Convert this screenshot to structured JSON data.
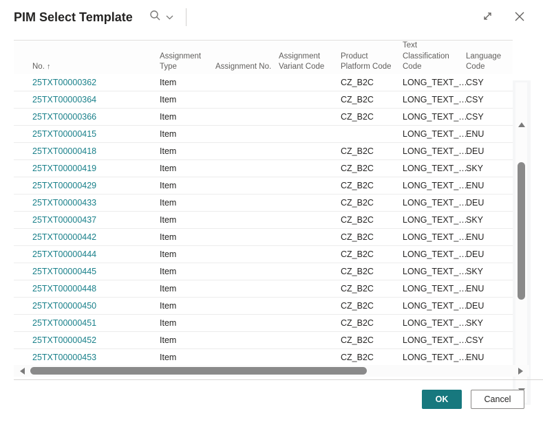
{
  "window": {
    "title": "PIM Select Template"
  },
  "icons": {
    "search": "search-magnifier",
    "chevron": "chevron-down",
    "expand": "expand-diagonal",
    "close": "close-x"
  },
  "table": {
    "columns": [
      {
        "key": "no",
        "label": "No.",
        "sort": "↑"
      },
      {
        "key": "assignment_type",
        "label": "Assignment Type"
      },
      {
        "key": "assignment_no",
        "label": "Assignment No."
      },
      {
        "key": "assignment_variant_code",
        "label": "Assignment Variant Code"
      },
      {
        "key": "product_platform_code",
        "label": "Product Platform Code"
      },
      {
        "key": "text_classification_code",
        "label": "Text Classification Code"
      },
      {
        "key": "language_code",
        "label": "Language Code"
      }
    ],
    "rows": [
      {
        "no": "25TXT00000362",
        "assignment_type": "Item",
        "assignment_no": "",
        "assignment_variant_code": "",
        "product_platform_code": "CZ_B2C",
        "text_classification_code": "LONG_TEXT_…",
        "language_code": "CSY"
      },
      {
        "no": "25TXT00000364",
        "assignment_type": "Item",
        "assignment_no": "",
        "assignment_variant_code": "",
        "product_platform_code": "CZ_B2C",
        "text_classification_code": "LONG_TEXT_…",
        "language_code": "CSY"
      },
      {
        "no": "25TXT00000366",
        "assignment_type": "Item",
        "assignment_no": "",
        "assignment_variant_code": "",
        "product_platform_code": "CZ_B2C",
        "text_classification_code": "LONG_TEXT_…",
        "language_code": "CSY"
      },
      {
        "no": "25TXT00000415",
        "assignment_type": "Item",
        "assignment_no": "",
        "assignment_variant_code": "",
        "product_platform_code": "",
        "text_classification_code": "LONG_TEXT_…",
        "language_code": "ENU"
      },
      {
        "no": "25TXT00000418",
        "assignment_type": "Item",
        "assignment_no": "",
        "assignment_variant_code": "",
        "product_platform_code": "CZ_B2C",
        "text_classification_code": "LONG_TEXT_…",
        "language_code": "DEU"
      },
      {
        "no": "25TXT00000419",
        "assignment_type": "Item",
        "assignment_no": "",
        "assignment_variant_code": "",
        "product_platform_code": "CZ_B2C",
        "text_classification_code": "LONG_TEXT_…",
        "language_code": "SKY"
      },
      {
        "no": "25TXT00000429",
        "assignment_type": "Item",
        "assignment_no": "",
        "assignment_variant_code": "",
        "product_platform_code": "CZ_B2C",
        "text_classification_code": "LONG_TEXT_…",
        "language_code": "ENU"
      },
      {
        "no": "25TXT00000433",
        "assignment_type": "Item",
        "assignment_no": "",
        "assignment_variant_code": "",
        "product_platform_code": "CZ_B2C",
        "text_classification_code": "LONG_TEXT_…",
        "language_code": "DEU"
      },
      {
        "no": "25TXT00000437",
        "assignment_type": "Item",
        "assignment_no": "",
        "assignment_variant_code": "",
        "product_platform_code": "CZ_B2C",
        "text_classification_code": "LONG_TEXT_…",
        "language_code": "SKY"
      },
      {
        "no": "25TXT00000442",
        "assignment_type": "Item",
        "assignment_no": "",
        "assignment_variant_code": "",
        "product_platform_code": "CZ_B2C",
        "text_classification_code": "LONG_TEXT_…",
        "language_code": "ENU"
      },
      {
        "no": "25TXT00000444",
        "assignment_type": "Item",
        "assignment_no": "",
        "assignment_variant_code": "",
        "product_platform_code": "CZ_B2C",
        "text_classification_code": "LONG_TEXT_…",
        "language_code": "DEU"
      },
      {
        "no": "25TXT00000445",
        "assignment_type": "Item",
        "assignment_no": "",
        "assignment_variant_code": "",
        "product_platform_code": "CZ_B2C",
        "text_classification_code": "LONG_TEXT_…",
        "language_code": "SKY"
      },
      {
        "no": "25TXT00000448",
        "assignment_type": "Item",
        "assignment_no": "",
        "assignment_variant_code": "",
        "product_platform_code": "CZ_B2C",
        "text_classification_code": "LONG_TEXT_…",
        "language_code": "ENU"
      },
      {
        "no": "25TXT00000450",
        "assignment_type": "Item",
        "assignment_no": "",
        "assignment_variant_code": "",
        "product_platform_code": "CZ_B2C",
        "text_classification_code": "LONG_TEXT_…",
        "language_code": "DEU"
      },
      {
        "no": "25TXT00000451",
        "assignment_type": "Item",
        "assignment_no": "",
        "assignment_variant_code": "",
        "product_platform_code": "CZ_B2C",
        "text_classification_code": "LONG_TEXT_…",
        "language_code": "SKY"
      },
      {
        "no": "25TXT00000452",
        "assignment_type": "Item",
        "assignment_no": "",
        "assignment_variant_code": "",
        "product_platform_code": "CZ_B2C",
        "text_classification_code": "LONG_TEXT_…",
        "language_code": "CSY"
      },
      {
        "no": "25TXT00000453",
        "assignment_type": "Item",
        "assignment_no": "",
        "assignment_variant_code": "",
        "product_platform_code": "CZ_B2C",
        "text_classification_code": "LONG_TEXT_…",
        "language_code": "ENU"
      }
    ]
  },
  "footer": {
    "ok_label": "OK",
    "cancel_label": "Cancel"
  },
  "colors": {
    "accent": "#17787E",
    "link": "#19808A"
  }
}
